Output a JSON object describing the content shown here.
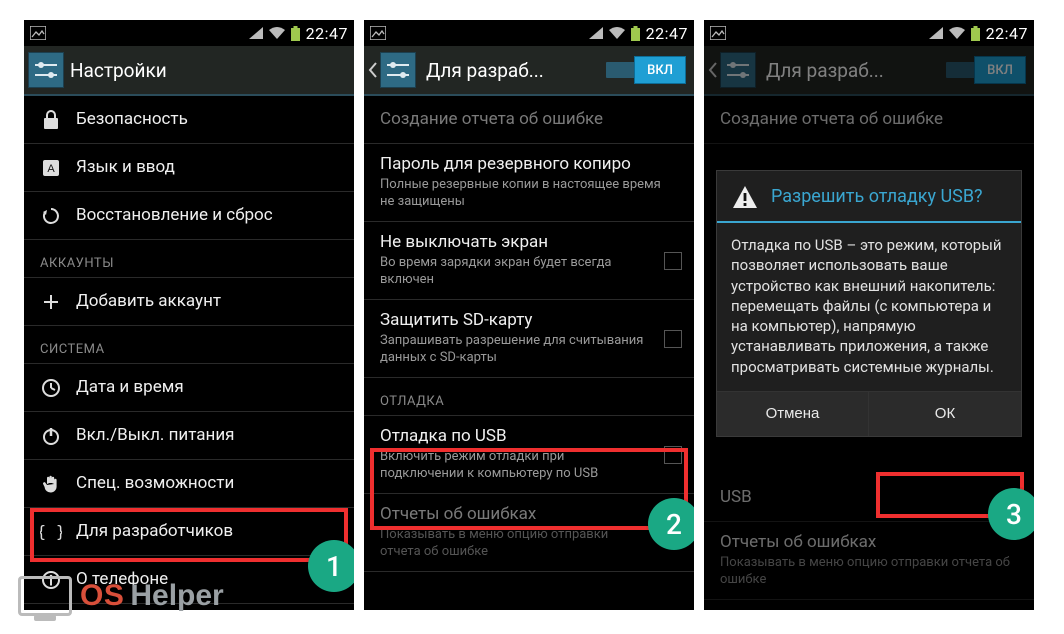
{
  "status": {
    "time": "22:47"
  },
  "steps": {
    "s1": "1",
    "s2": "2",
    "s3": "3"
  },
  "watermark": {
    "os": "OS",
    "helper": "Helper"
  },
  "phone1": {
    "title": "Настройки",
    "items": {
      "security": "Безопасность",
      "lang": "Язык и ввод",
      "backup": "Восстановление и сброс"
    },
    "headers": {
      "accounts": "АККАУНТЫ",
      "system": "СИСТЕМА"
    },
    "accounts": {
      "add": "Добавить аккаунт"
    },
    "system": {
      "datetime": "Дата и время",
      "power": "Вкл./Выкл. питания",
      "access": "Спец. возможности",
      "dev": "Для разработчиков",
      "about": "О телефоне"
    }
  },
  "phone2": {
    "title": "Для разраб...",
    "switch": "ВКЛ",
    "rows": {
      "bugreport": {
        "t": "Создание отчета об ошибке"
      },
      "backup_pw": {
        "t": "Пароль для резервного копиро",
        "s": "Полные резервные копии в настоящее время не защищены"
      },
      "stayon": {
        "t": "Не выключать экран",
        "s": "Во время зарядки экран будет всегда включен"
      },
      "sdprotect": {
        "t": "Защитить SD-карту",
        "s": "Запрашивать разрешение для считывания данных с SD-карты"
      },
      "header_debug": "ОТЛАДКА",
      "usb": {
        "t": "Отладка по USB",
        "s": "Включить режим отладки при подключении к компьютеру по USB"
      },
      "errreports": {
        "t": "Отчеты об ошибках",
        "s": "Показывать в меню опцию отправки отчета об ошибке"
      }
    }
  },
  "phone3": {
    "title": "Для разраб...",
    "switch": "ВКЛ",
    "dialog": {
      "title": "Разрешить отладку USB?",
      "body": "Отладка по USB – это режим, который позволяет использовать ваше устройство как внешний накопитель: перемещать файлы (с компьютера и на компьютер), напрямую устанавливать приложения, а также просматривать системные журналы.",
      "cancel": "Отмена",
      "ok": "ОК"
    },
    "bg": {
      "bugreport": "Создание отчета об ошибке",
      "usb": "USB",
      "err_t": "Отчеты об ошибках",
      "err_s": "Показывать в меню опцию отправки отчета об ошибке"
    }
  }
}
